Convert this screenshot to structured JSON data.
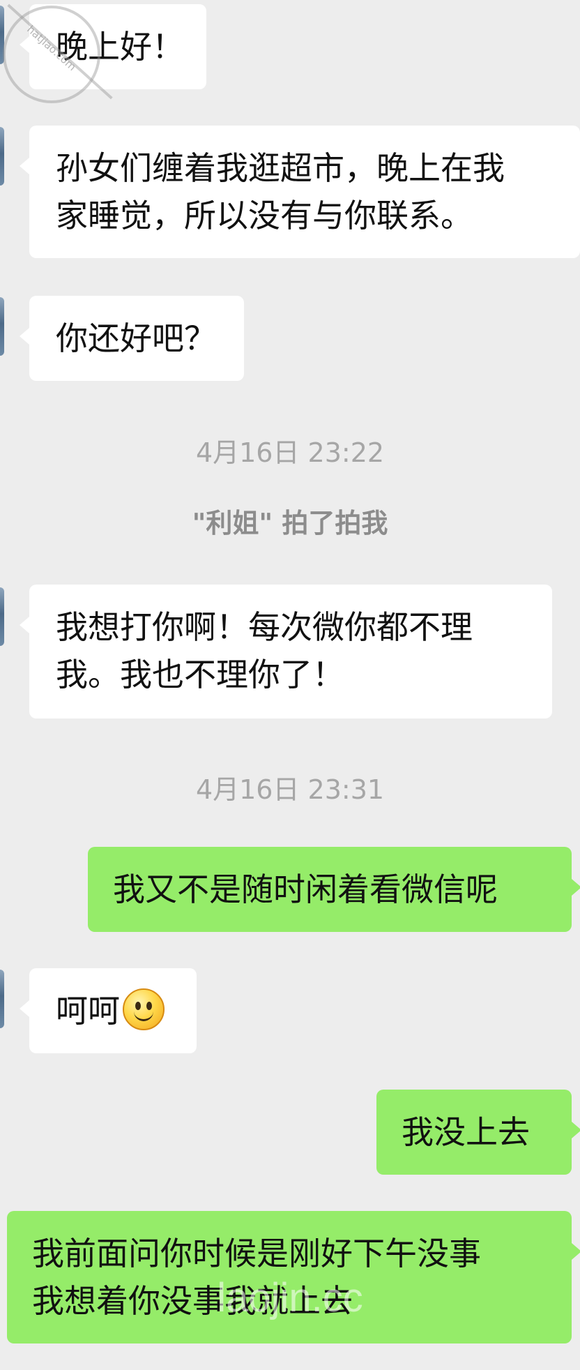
{
  "messages": {
    "m1": {
      "text": "晚上好！"
    },
    "m2": {
      "lines": [
        "孙女们缠着我逛超市，晚上在我",
        "家睡觉，所以没有与你联系。"
      ]
    },
    "m3": {
      "text": "你还好吧？"
    },
    "m4": {
      "lines": [
        "我想打你啊！每次微你都不理",
        "我。我也不理你了！"
      ]
    },
    "m5": {
      "text": "我又不是随时闲着看微信呢"
    },
    "m6": {
      "text": "呵呵",
      "emoji": "smiling-face-emoji"
    },
    "m7": {
      "text": "我没上去"
    },
    "m8": {
      "lines": [
        "我前面问你时候是刚好下午没事",
        "我想着你没事我就上去"
      ]
    }
  },
  "timestamps": [
    "4月16日 23:22",
    "4月16日 23:31"
  ],
  "system_message": "\"利姐\" 拍了拍我",
  "watermarks": {
    "seal_text": "hatjiao.com",
    "bottom_text": "laojin.cc"
  },
  "colors": {
    "background": "#ededed",
    "incoming_bubble": "#ffffff",
    "outgoing_bubble": "#95ec69",
    "timestamp_text": "#a6a6a6"
  }
}
